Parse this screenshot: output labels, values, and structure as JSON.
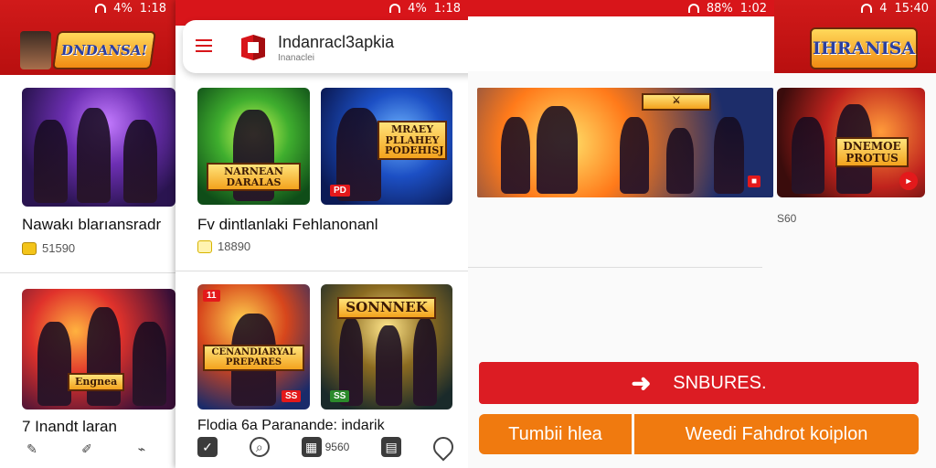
{
  "status_left": {
    "time": "1:18",
    "battery": "4%"
  },
  "status_right": {
    "time": "1:02",
    "battery": "88%"
  },
  "status_far_right": {
    "time": "15:40",
    "battery": "4"
  },
  "left_screen": {
    "logo_text": "DNDANSA!",
    "cards": [
      {
        "title": "Nawakı blarıansradr",
        "price": "51590"
      },
      {
        "title": "7 Inandt laran",
        "image_label": "Engnea"
      }
    ]
  },
  "center_screen": {
    "app_name": "Indanracl3apkia",
    "app_subtitle": "Inanaclei",
    "cards": [
      {
        "image_label": "NARNEAN DARALAS"
      },
      {
        "image_label": "MRAEY PLLAHEY PODEHISJ",
        "badge": "PD"
      }
    ],
    "row1_title": "Fv dintlanlaki Fehlanonanl",
    "row1_price": "18890",
    "cards_row2": [
      {
        "image_label": "CENANDIARYAL PREPARES",
        "badge_top": "11",
        "badge_bottom": "SS"
      },
      {
        "image_label": "SONNNEK",
        "badge_bottom": "SS"
      }
    ],
    "row2_title": "Flodia 6a Paranande: indarik",
    "bottom_label": "9560"
  },
  "right_screen": {
    "logo_text": "IHRANISA",
    "banner_label": "DNEMOE PROTUS",
    "side_price": "S60",
    "primary_button": "SNBURES.",
    "secondary_left": "Tumbii hlea",
    "secondary_right": "Weedi Fahdrot koiplon"
  },
  "colors": {
    "brand_red": "#d8151a",
    "orange": "#f07a0f"
  }
}
